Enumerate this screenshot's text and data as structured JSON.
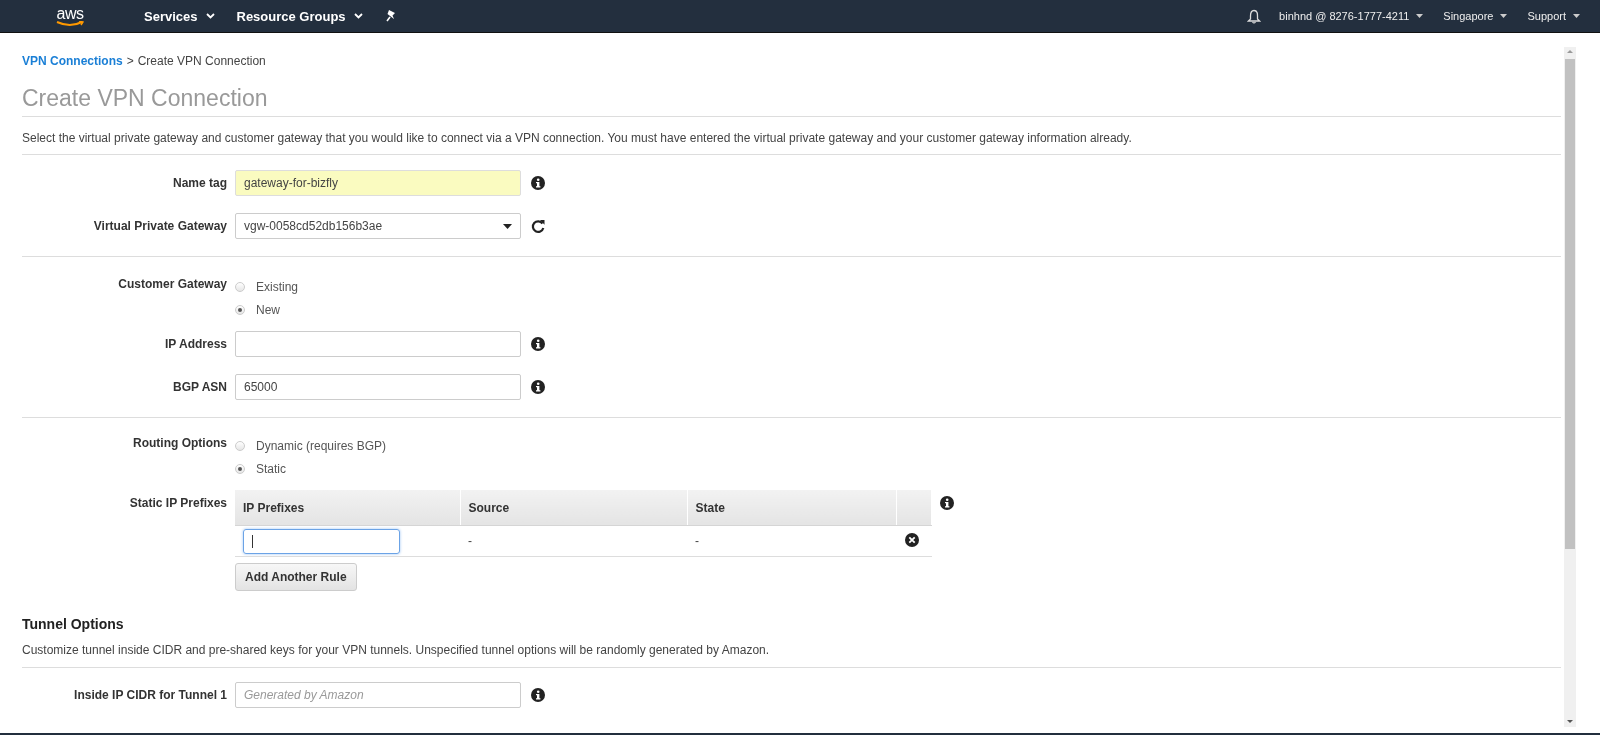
{
  "nav": {
    "logo": "aws",
    "menus": [
      {
        "label": "Services"
      },
      {
        "label": "Resource Groups"
      }
    ],
    "account": "binhnd @ 8276-1777-4211",
    "region": "Singapore",
    "support": "Support"
  },
  "breadcrumb": {
    "link": "VPN Connections",
    "separator": ">",
    "current": "Create VPN Connection"
  },
  "title": "Create VPN Connection",
  "description": "Select the virtual private gateway and customer gateway that you would like to connect via a VPN connection. You must have entered the virtual private gateway and your customer gateway information already.",
  "sections": [
    {
      "rows": [
        {
          "kind": "text",
          "label": "Name tag",
          "value": "gateway-for-bizfly",
          "highlighted": true
        },
        {
          "kind": "select",
          "label": "Virtual Private Gateway",
          "value": "vgw-0058cd52db156b3ae"
        }
      ]
    },
    {
      "rows": [
        {
          "kind": "radio",
          "label": "Customer Gateway",
          "options": [
            {
              "label": "Existing",
              "selected": false
            },
            {
              "label": "New",
              "selected": true
            }
          ]
        },
        {
          "kind": "text",
          "label": "IP Address",
          "highlighted": false
        },
        {
          "kind": "text",
          "label": "BGP ASN",
          "value": "65000",
          "highlighted": false
        }
      ]
    },
    {
      "rows": [
        {
          "kind": "radio",
          "label": "Routing Options",
          "options": [
            {
              "label": "Dynamic (requires BGP)",
              "selected": false
            },
            {
              "label": "Static",
              "selected": true
            }
          ]
        },
        {
          "kind": "table",
          "label": "Static IP Prefixes",
          "columns": [
            "IP Prefixes",
            "Source",
            "State"
          ],
          "rows": [
            {
              "source": "-",
              "state": "-",
              "focused": true
            }
          ],
          "button": "Add Another Rule"
        }
      ]
    }
  ],
  "tunnel": {
    "heading": "Tunnel Options",
    "description": "Customize tunnel inside CIDR and pre-shared keys for your VPN tunnels. Unspecified tunnel options will be randomly generated by Amazon.",
    "rows": [
      {
        "kind": "text",
        "label": "Inside IP CIDR for Tunnel 1",
        "placeholder": "Generated by Amazon",
        "highlighted": false
      }
    ]
  }
}
